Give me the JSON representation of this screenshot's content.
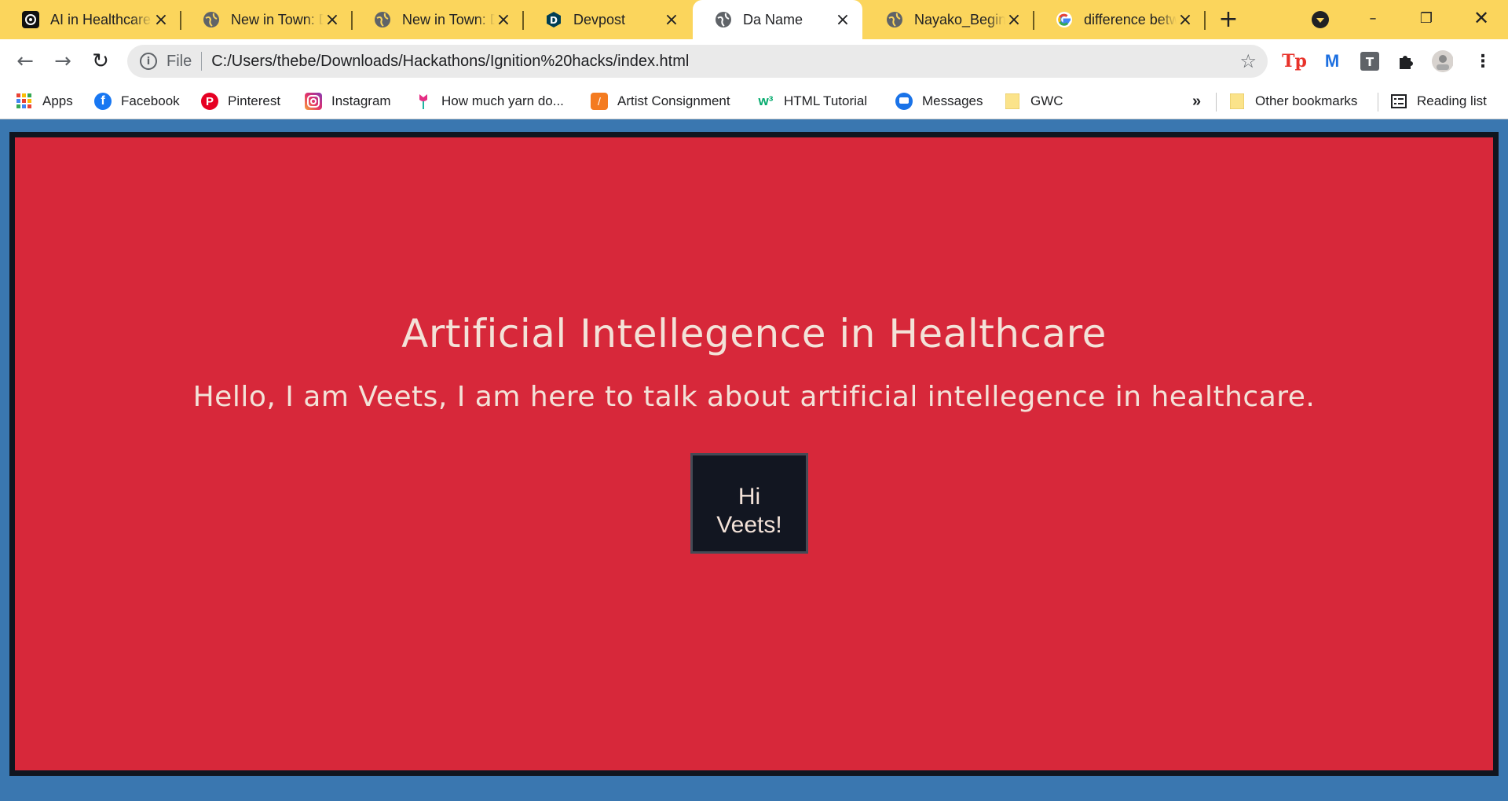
{
  "tabs": [
    {
      "title": "AI in Healthcare",
      "icon": "ai-logo-icon",
      "active": false
    },
    {
      "title": "New in Town: D",
      "icon": "globe-icon",
      "active": false
    },
    {
      "title": "New in Town: D",
      "icon": "globe-icon",
      "active": false
    },
    {
      "title": "Devpost",
      "icon": "devpost-icon",
      "active": false
    },
    {
      "title": "Da Name",
      "icon": "globe-icon",
      "active": true
    },
    {
      "title": "Nayako_Beginn",
      "icon": "globe-icon",
      "active": false
    },
    {
      "title": "difference betw",
      "icon": "google-icon",
      "active": false
    }
  ],
  "toolbar": {
    "scheme": "File",
    "url": "C:/Users/thebe/Downloads/Hackathons/Ignition%20hacks/index.html"
  },
  "bookmarks": {
    "items": [
      {
        "label": "Apps",
        "icon": "apps-grid-icon"
      },
      {
        "label": "Facebook",
        "icon": "facebook-icon"
      },
      {
        "label": "Pinterest",
        "icon": "pinterest-icon"
      },
      {
        "label": "Instagram",
        "icon": "instagram-icon"
      },
      {
        "label": "How much yarn do...",
        "icon": "tulip-icon"
      },
      {
        "label": "Artist Consignment",
        "icon": "artist-consignment-icon"
      },
      {
        "label": "HTML Tutorial",
        "icon": "w3schools-icon"
      },
      {
        "label": "Messages",
        "icon": "messages-icon"
      },
      {
        "label": "GWC",
        "icon": "folder-icon"
      }
    ],
    "overflow": "»",
    "other": "Other bookmarks",
    "reading_list": "Reading list"
  },
  "page": {
    "heading": "Artificial Intellegence in Healthcare",
    "subline": "Hello, I am Veets, I am here to talk about artificial intellegence in healthcare.",
    "button_line1": "Hi",
    "button_line2": "Veets!"
  },
  "colors": {
    "tab_strip": "#fbd55c",
    "page_background": "#3a77b0",
    "panel": "#d7283a",
    "panel_border": "#10151f",
    "text": "#f3e2d8",
    "button": "#121621"
  }
}
